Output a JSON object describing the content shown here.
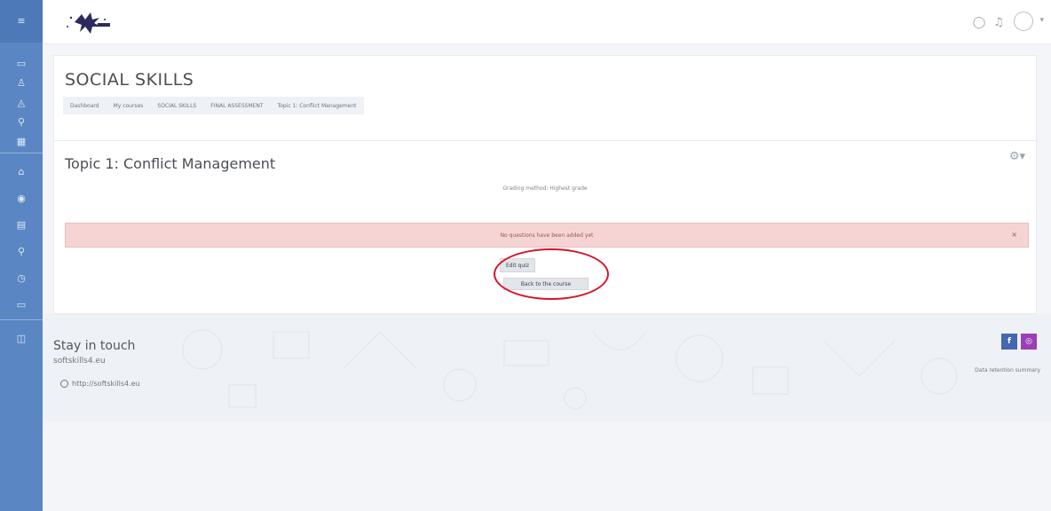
{
  "header": {
    "icons": [
      "chat-icon",
      "bell-icon",
      "user-avatar-icon",
      "chevron-down-icon"
    ]
  },
  "course": {
    "title": "SOCIAL SKILLS",
    "breadcrumbs": [
      "Dashboard",
      "My courses",
      "SOCIAL SKILLS",
      "FINAL ASSESSMENT",
      "Topic 1: Conflict Management"
    ]
  },
  "quiz": {
    "title": "Topic 1: Conflict Management",
    "grading_method": "Grading method: Highest grade",
    "alert": "No questions have been added yet",
    "alert_close": "×",
    "edit_button": "Edit quiz",
    "back_button": "Back to the course"
  },
  "footer": {
    "stay_in_touch": "Stay in touch",
    "site": "softskills4.eu",
    "url": "http://softskills4.eu",
    "social": {
      "facebook": "f",
      "instagram": "◎"
    },
    "data_retention": "Data retention summary"
  },
  "colors": {
    "nav": "#5a86c3",
    "alert_bg": "#f6d4d4",
    "highlight": "#d7122a",
    "facebook": "#4566b0",
    "instagram": "#9a3fb6"
  }
}
